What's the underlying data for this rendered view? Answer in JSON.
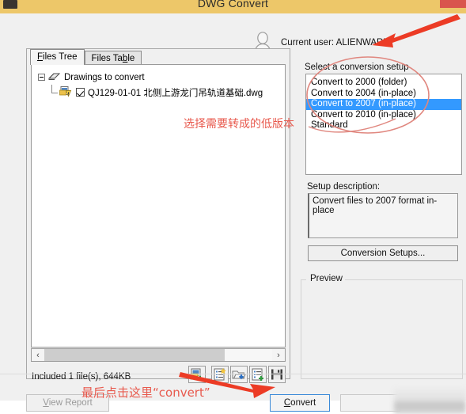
{
  "window": {
    "title": "DWG Convert",
    "close_label": "",
    "app_icon": "app-icon"
  },
  "user": {
    "label": "Current user: ALIENWARE",
    "avatar_icon": "user-avatar-icon"
  },
  "left_panel": {
    "tabs": [
      {
        "label": "Files Tree",
        "active": true
      },
      {
        "label": "Files Table",
        "active": false
      }
    ],
    "tree": {
      "root_label": "Drawings to convert",
      "child_label": "QJ129-01-01 北侧上游龙门吊轨道基础.dwg",
      "child_checked": true
    },
    "status_text": "Included 1 file(s), 644KB",
    "toolbar": [
      {
        "name": "add-drawings-icon",
        "title": "Add drawings"
      },
      {
        "name": "new-list-icon",
        "title": "New list"
      },
      {
        "name": "open-list-icon",
        "title": "Open list"
      },
      {
        "name": "append-list-icon",
        "title": "Append to list"
      },
      {
        "name": "save-list-icon",
        "title": "Save list"
      }
    ],
    "scrollbar": {
      "left_arrow": "‹",
      "right_arrow": "›"
    }
  },
  "right_panel": {
    "setup_label": "Select a conversion setup",
    "setups": [
      {
        "label": "Convert to 2000 (folder)",
        "selected": false
      },
      {
        "label": "Convert to 2004 (in-place)",
        "selected": false
      },
      {
        "label": "Convert to 2007 (in-place)",
        "selected": true
      },
      {
        "label": "Convert to 2010 (in-place)",
        "selected": false
      },
      {
        "label": "Standard",
        "selected": false
      }
    ],
    "description_label": "Setup description:",
    "description_text": "Convert files to 2007 format in-place",
    "setups_button": "Conversion Setups...",
    "preview_label": "Preview"
  },
  "bottom": {
    "view_report": "View Report",
    "convert": "Convert",
    "masked_button": ""
  },
  "annotations": [
    {
      "text": "选择需要转成的低版本",
      "name": "annotation-select-version"
    },
    {
      "text": "最后点击这里“convert”",
      "name": "annotation-click-convert"
    }
  ],
  "colors": {
    "titlebar": "#edc769",
    "selection": "#3399ff",
    "annotation": "#e8594d",
    "close_button": "#d9554d"
  }
}
